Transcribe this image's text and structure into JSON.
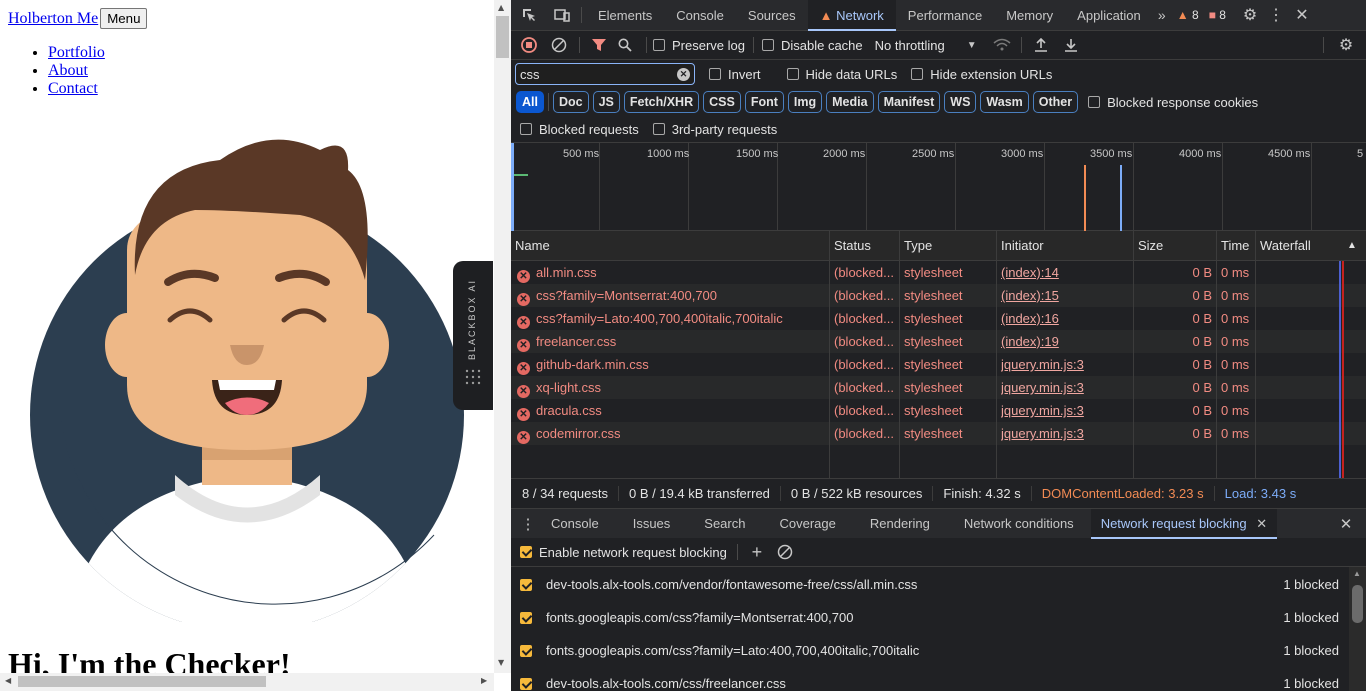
{
  "page": {
    "brand": "Holberton Me",
    "menu_button": "Menu",
    "nav": [
      "Portfolio",
      "About",
      "Contact"
    ],
    "heading": "Hi, I'm the Checker!"
  },
  "blackbox": {
    "label": "BLACKBOX AI"
  },
  "devtools": {
    "tabs": [
      "Elements",
      "Console",
      "Sources",
      "Network",
      "Performance",
      "Memory",
      "Application"
    ],
    "active_tab": "Network",
    "warning_count": "8",
    "error_count": "8",
    "toolbar": {
      "preserve_log": "Preserve log",
      "disable_cache": "Disable cache",
      "throttling": "No throttling"
    },
    "filter": {
      "value": "css",
      "invert": "Invert",
      "hide_data_urls": "Hide data URLs",
      "hide_extension_urls": "Hide extension URLs"
    },
    "type_filters": [
      "All",
      "Doc",
      "JS",
      "Fetch/XHR",
      "CSS",
      "Font",
      "Img",
      "Media",
      "Manifest",
      "WS",
      "Wasm",
      "Other"
    ],
    "blocked_response_cookies": "Blocked response cookies",
    "blocked_requests": "Blocked requests",
    "third_party_requests": "3rd-party requests",
    "timeline_labels": [
      "500 ms",
      "1000 ms",
      "1500 ms",
      "2000 ms",
      "2500 ms",
      "3000 ms",
      "3500 ms",
      "4000 ms",
      "4500 ms",
      "5"
    ],
    "columns": [
      "Name",
      "Status",
      "Type",
      "Initiator",
      "Size",
      "Time",
      "Waterfall"
    ],
    "requests": [
      {
        "name": "all.min.css",
        "status": "(blocked...",
        "type": "stylesheet",
        "initiator": "(index):14",
        "size": "0 B",
        "time": "0 ms"
      },
      {
        "name": "css?family=Montserrat:400,700",
        "status": "(blocked...",
        "type": "stylesheet",
        "initiator": "(index):15",
        "size": "0 B",
        "time": "0 ms"
      },
      {
        "name": "css?family=Lato:400,700,400italic,700italic",
        "status": "(blocked...",
        "type": "stylesheet",
        "initiator": "(index):16",
        "size": "0 B",
        "time": "0 ms"
      },
      {
        "name": "freelancer.css",
        "status": "(blocked...",
        "type": "stylesheet",
        "initiator": "(index):19",
        "size": "0 B",
        "time": "0 ms"
      },
      {
        "name": "github-dark.min.css",
        "status": "(blocked...",
        "type": "stylesheet",
        "initiator": "jquery.min.js:3",
        "size": "0 B",
        "time": "0 ms"
      },
      {
        "name": "xq-light.css",
        "status": "(blocked...",
        "type": "stylesheet",
        "initiator": "jquery.min.js:3",
        "size": "0 B",
        "time": "0 ms"
      },
      {
        "name": "dracula.css",
        "status": "(blocked...",
        "type": "stylesheet",
        "initiator": "jquery.min.js:3",
        "size": "0 B",
        "time": "0 ms"
      },
      {
        "name": "codemirror.css",
        "status": "(blocked...",
        "type": "stylesheet",
        "initiator": "jquery.min.js:3",
        "size": "0 B",
        "time": "0 ms"
      }
    ],
    "summary": {
      "requests": "8 / 34 requests",
      "transferred": "0 B / 19.4 kB transferred",
      "resources": "0 B / 522 kB resources",
      "finish": "Finish: 4.32 s",
      "dom_content_loaded": "DOMContentLoaded: 3.23 s",
      "load": "Load: 3.43 s"
    },
    "drawer_tabs": [
      "Console",
      "Issues",
      "Search",
      "Coverage",
      "Rendering",
      "Network conditions",
      "Network request blocking"
    ],
    "drawer_active": "Network request blocking",
    "enable_blocking": "Enable network request blocking",
    "blocked_patterns": [
      {
        "pattern": "dev-tools.alx-tools.com/vendor/fontawesome-free/css/all.min.css",
        "count": "1 blocked"
      },
      {
        "pattern": "fonts.googleapis.com/css?family=Montserrat:400,700",
        "count": "1 blocked"
      },
      {
        "pattern": "fonts.googleapis.com/css?family=Lato:400,700,400italic,700italic",
        "count": "1 blocked"
      },
      {
        "pattern": "dev-tools.alx-tools.com/css/freelancer.css",
        "count": "1 blocked"
      }
    ],
    "colors": {
      "accent": "#a8c7fa",
      "error": "#e46962",
      "dom_content_loaded": "#f28b54",
      "load": "#7cacf8",
      "avatar_bg": "#2c3e50",
      "skin": "#eeb887",
      "hair": "#5a3826"
    }
  }
}
